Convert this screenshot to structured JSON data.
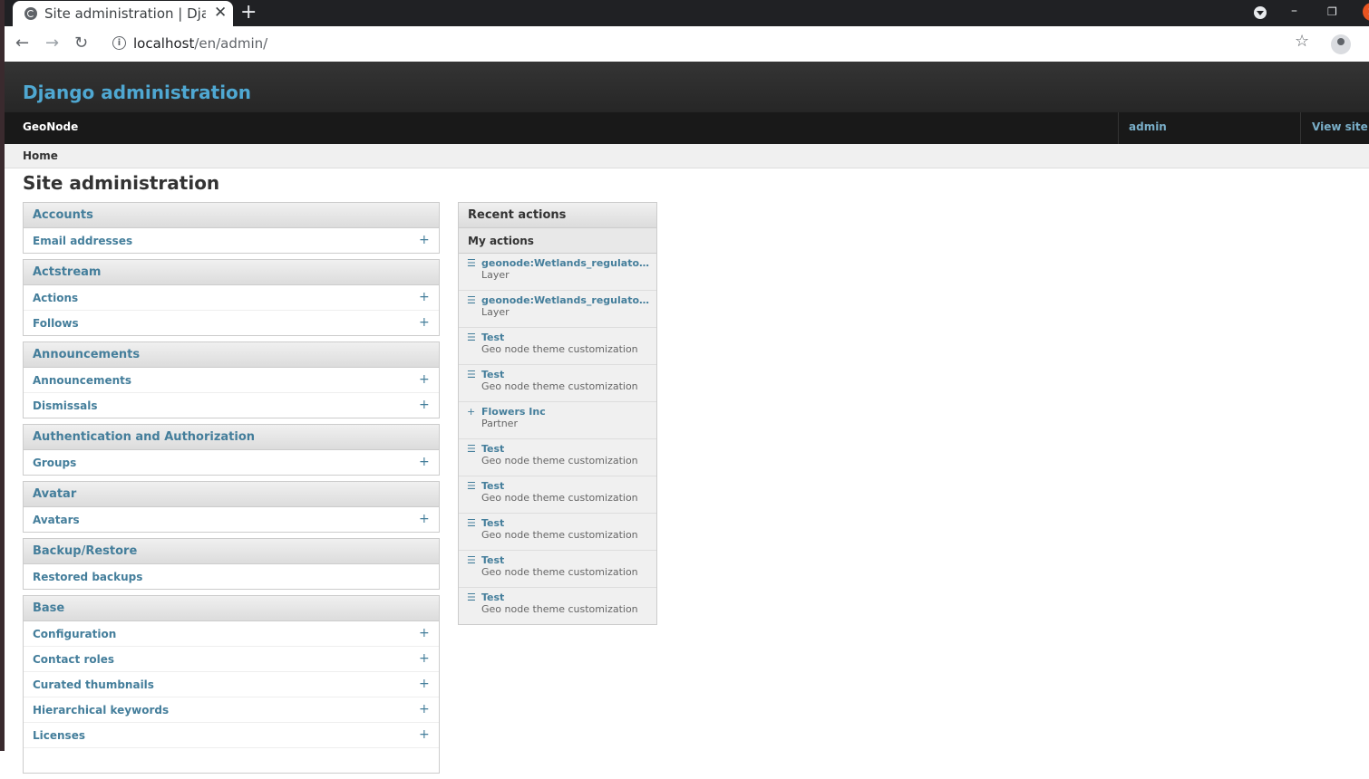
{
  "browser": {
    "tab_title": "Site administration | Django site admin",
    "url_host": "localhost",
    "url_path": "/en/admin/"
  },
  "header": {
    "branding": "Django administration",
    "site_name": "GeoNode",
    "user": "admin",
    "view_site": "View site"
  },
  "breadcrumb": "Home",
  "page_title": "Site administration",
  "modules": [
    {
      "name": "Accounts",
      "models": [
        {
          "label": "Email addresses",
          "add": true
        }
      ]
    },
    {
      "name": "Actstream",
      "models": [
        {
          "label": "Actions",
          "add": true
        },
        {
          "label": "Follows",
          "add": true
        }
      ]
    },
    {
      "name": "Announcements",
      "models": [
        {
          "label": "Announcements",
          "add": true
        },
        {
          "label": "Dismissals",
          "add": true
        }
      ]
    },
    {
      "name": "Authentication and Authorization",
      "models": [
        {
          "label": "Groups",
          "add": true
        }
      ]
    },
    {
      "name": "Avatar",
      "models": [
        {
          "label": "Avatars",
          "add": true
        }
      ]
    },
    {
      "name": "Backup/Restore",
      "models": [
        {
          "label": "Restored backups",
          "add": false
        }
      ]
    },
    {
      "name": "Base",
      "models": [
        {
          "label": "Configuration",
          "add": true
        },
        {
          "label": "Contact roles",
          "add": true
        },
        {
          "label": "Curated thumbnails",
          "add": true
        },
        {
          "label": "Hierarchical keywords",
          "add": true
        },
        {
          "label": "Licenses",
          "add": true
        },
        {
          "label": "",
          "add": false
        }
      ]
    }
  ],
  "recent_actions": {
    "title": "Recent actions",
    "subtitle": "My actions",
    "items": [
      {
        "icon": "change",
        "name": "geonode:Wetlands_regulatory_a...",
        "type": "Layer"
      },
      {
        "icon": "change",
        "name": "geonode:Wetlands_regulatory_a...",
        "type": "Layer"
      },
      {
        "icon": "change",
        "name": "Test",
        "type": "Geo node theme customization"
      },
      {
        "icon": "change",
        "name": "Test",
        "type": "Geo node theme customization"
      },
      {
        "icon": "add",
        "name": "Flowers Inc",
        "type": "Partner"
      },
      {
        "icon": "change",
        "name": "Test",
        "type": "Geo node theme customization"
      },
      {
        "icon": "change",
        "name": "Test",
        "type": "Geo node theme customization"
      },
      {
        "icon": "change",
        "name": "Test",
        "type": "Geo node theme customization"
      },
      {
        "icon": "change",
        "name": "Test",
        "type": "Geo node theme customization"
      },
      {
        "icon": "change",
        "name": "Test",
        "type": "Geo node theme customization"
      }
    ]
  },
  "add_glyph": "+",
  "change_glyph": "☰",
  "colors": {
    "link": "#447e9b",
    "branding": "#4fa8d2",
    "header_bg": "#262626"
  }
}
